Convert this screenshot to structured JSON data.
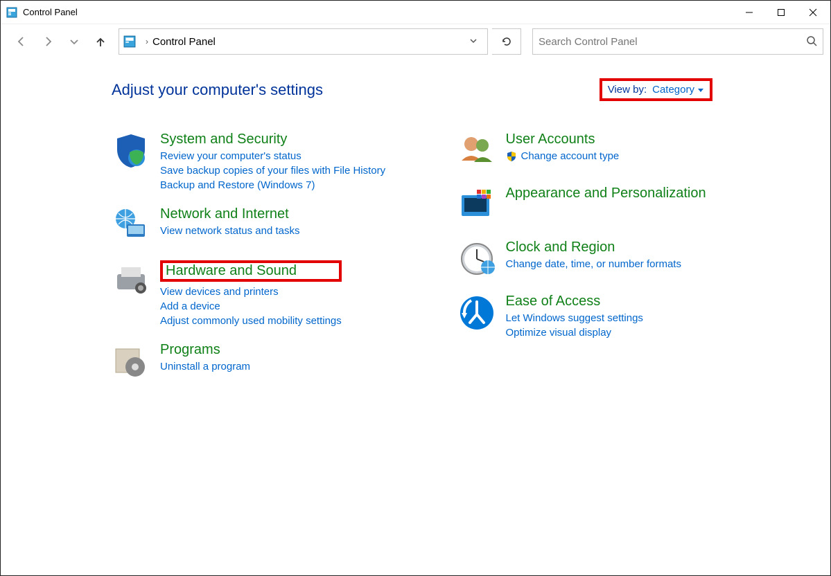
{
  "window": {
    "title": "Control Panel"
  },
  "toolbar": {
    "breadcrumb": "Control Panel",
    "search_placeholder": "Search Control Panel"
  },
  "page": {
    "heading": "Adjust your computer's settings",
    "viewby_label": "View by:",
    "viewby_value": "Category"
  },
  "categories": {
    "left": [
      {
        "title": "System and Security",
        "links": [
          "Review your computer's status",
          "Save backup copies of your files with File History",
          "Backup and Restore (Windows 7)"
        ]
      },
      {
        "title": "Network and Internet",
        "links": [
          "View network status and tasks"
        ]
      },
      {
        "title": "Hardware and Sound",
        "highlighted": true,
        "links": [
          "View devices and printers",
          "Add a device",
          "Adjust commonly used mobility settings"
        ]
      },
      {
        "title": "Programs",
        "links": [
          "Uninstall a program"
        ]
      }
    ],
    "right": [
      {
        "title": "User Accounts",
        "links": [
          {
            "text": "Change account type",
            "shield": true
          }
        ]
      },
      {
        "title": "Appearance and Personalization",
        "links": []
      },
      {
        "title": "Clock and Region",
        "links": [
          "Change date, time, or number formats"
        ]
      },
      {
        "title": "Ease of Access",
        "links": [
          "Let Windows suggest settings",
          "Optimize visual display"
        ]
      }
    ]
  }
}
